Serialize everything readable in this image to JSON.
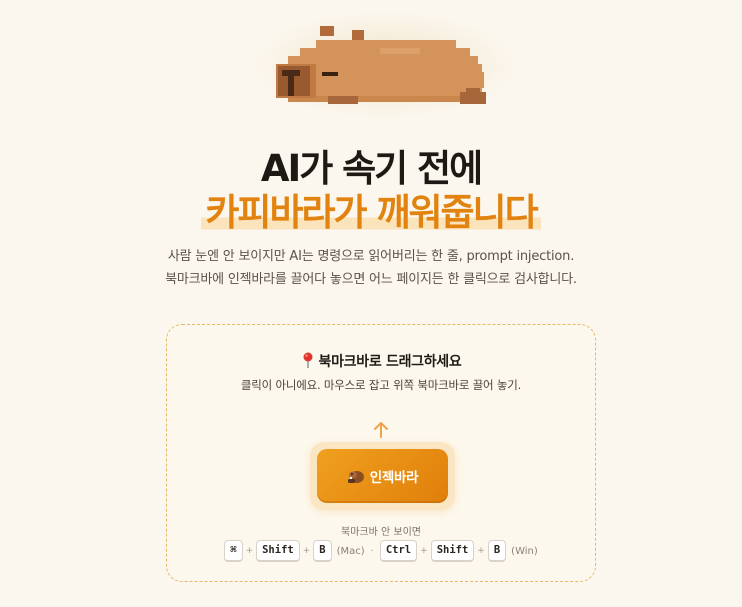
{
  "hero": {
    "title_line1": "AI가 속기 전에",
    "title_line2": "카피바라가 깨워줍니다",
    "description_line1": "사람 눈엔 안 보이지만 AI는 명령으로 읽어버리는 한 줄, prompt injection.",
    "description_line2": "북마크바에 인젝바라를 끌어다 놓으면 어느 페이지든 한 클릭으로 검사합니다.",
    "mascot_icon": "capybara-pixel-icon"
  },
  "install_card": {
    "title": "북마크바로 드래그하세요",
    "title_icon": "pin-icon",
    "subtitle": "클릭이 아니에요. 마우스로 잡고 위쪽 북마크바로 끌어 놓기.",
    "arrow_icon": "arrow-up-icon",
    "bookmarklet_label": "인젝바라",
    "bookmarklet_icon": "beaver-icon",
    "shortcut_caption": "북마크바 안 보이면",
    "mac_keys": [
      "⌘",
      "Shift",
      "B"
    ],
    "mac_label": "(Mac)",
    "separator": "·",
    "win_keys": [
      "Ctrl",
      "Shift",
      "B"
    ],
    "win_label": "(Win)",
    "plus": "+"
  },
  "colors": {
    "background": "#fbf7ee",
    "accent": "#e1830e",
    "title": "#1d1a16",
    "card_border": "#e8b766"
  }
}
